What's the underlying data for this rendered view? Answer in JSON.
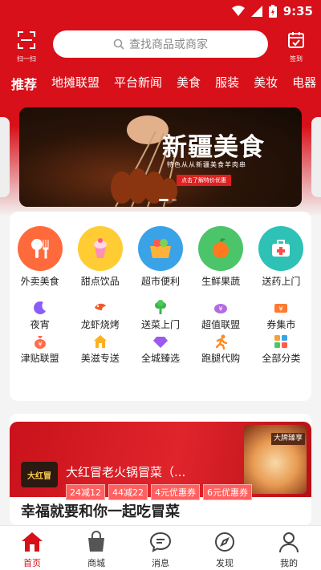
{
  "status": {
    "time": "9:35"
  },
  "topbar": {
    "scan_label": "扫一扫",
    "search_placeholder": "查找商品或商家",
    "sign_label": "签到"
  },
  "tabs": [
    {
      "label": "推荐",
      "active": true
    },
    {
      "label": "地摊联盟"
    },
    {
      "label": "平台新闻"
    },
    {
      "label": "美食"
    },
    {
      "label": "服装"
    },
    {
      "label": "美妆"
    },
    {
      "label": "电器"
    }
  ],
  "banner": {
    "title": "新疆美食",
    "subtitle": "特色从从新疆美食羊肉串",
    "button": "点击了解特价优惠"
  },
  "big_categories": [
    {
      "label": "外卖美食",
      "icon": "food-delivery-icon",
      "color": "#ff6a3d"
    },
    {
      "label": "甜点饮品",
      "icon": "dessert-drink-icon",
      "color": "#ffcc33"
    },
    {
      "label": "超市便利",
      "icon": "supermarket-icon",
      "color": "#3aa3e8"
    },
    {
      "label": "生鲜果蔬",
      "icon": "fresh-produce-icon",
      "color": "#4cc46a"
    },
    {
      "label": "送药上门",
      "icon": "medicine-icon",
      "color": "#2ec1b6"
    }
  ],
  "small_categories": [
    [
      {
        "label": "夜宵",
        "icon": "moon-icon",
        "color": "#8b5cf6"
      },
      {
        "label": "龙虾烧烤",
        "icon": "lobster-icon",
        "color": "#f05a28"
      },
      {
        "label": "送菜上门",
        "icon": "vegetable-icon",
        "color": "#3bb54a"
      },
      {
        "label": "超值联盟",
        "icon": "piggy-bank-icon",
        "color": "#b36ae2"
      },
      {
        "label": "券集市",
        "icon": "coupon-icon",
        "color": "#ff7a2e"
      }
    ],
    [
      {
        "label": "津贴联盟",
        "icon": "money-bag-icon",
        "color": "#ff6b4a"
      },
      {
        "label": "美滋专送",
        "icon": "house-icon",
        "color": "#ffb020"
      },
      {
        "label": "全城臻选",
        "icon": "diamond-icon",
        "color": "#9b59f0"
      },
      {
        "label": "跑腿代购",
        "icon": "runner-icon",
        "color": "#ff8a1f"
      },
      {
        "label": "全部分类",
        "icon": "grid-icon",
        "color": "#f2a33a"
      }
    ]
  ],
  "store": {
    "logo": "大红冒",
    "name": "大红冒老火锅冒菜（...",
    "badge": "大牌臻享",
    "coupons": [
      "24减12",
      "44减22",
      "4元优惠券",
      "6元优惠券"
    ]
  },
  "section_title": "幸福就要和你一起吃冒菜",
  "bottom_nav": [
    {
      "label": "首页",
      "icon": "home-icon",
      "active": true
    },
    {
      "label": "商城",
      "icon": "shopping-bag-icon"
    },
    {
      "label": "消息",
      "icon": "message-icon"
    },
    {
      "label": "发现",
      "icon": "compass-icon"
    },
    {
      "label": "我的",
      "icon": "user-icon"
    }
  ],
  "colors": {
    "primary": "#d7101a"
  }
}
